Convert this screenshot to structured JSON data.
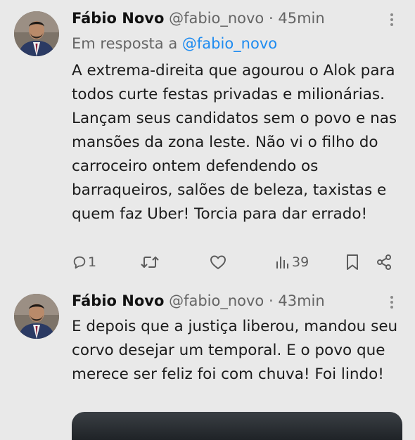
{
  "tweets": [
    {
      "author_name": "Fábio Novo",
      "author_handle": "@fabio_novo",
      "separator": "·",
      "time": "45min",
      "reply_prefix": "Em resposta a",
      "reply_to": "@fabio_novo",
      "text": "A extrema-direita que agourou o Alok para todos curte festas privadas e milionárias. Lançam seus candidatos sem o povo e nas mansões da zona leste. Não vi o filho do carroceiro ontem defendendo os barraqueiros, salões de beleza, taxistas e quem faz Uber! Torcia para dar errado!",
      "actions": {
        "reply_count": "1",
        "retweet_count": "",
        "like_count": "",
        "views_count": "39"
      }
    },
    {
      "author_name": "Fábio Novo",
      "author_handle": "@fabio_novo",
      "separator": "·",
      "time": "43min",
      "text": "E depois que a justiça liberou, mandou seu corvo desejar um temporal. E o povo que merece ser feliz foi com chuva! Foi lindo!"
    }
  ],
  "icons": {
    "more": "more-vertical-icon",
    "reply": "reply-icon",
    "retweet": "retweet-icon",
    "like": "heart-icon",
    "views": "views-icon",
    "bookmark": "bookmark-icon",
    "share": "share-icon"
  },
  "colors": {
    "background": "#e9e9e9",
    "mention": "#1d8bf0",
    "secondary_text": "#656565"
  }
}
